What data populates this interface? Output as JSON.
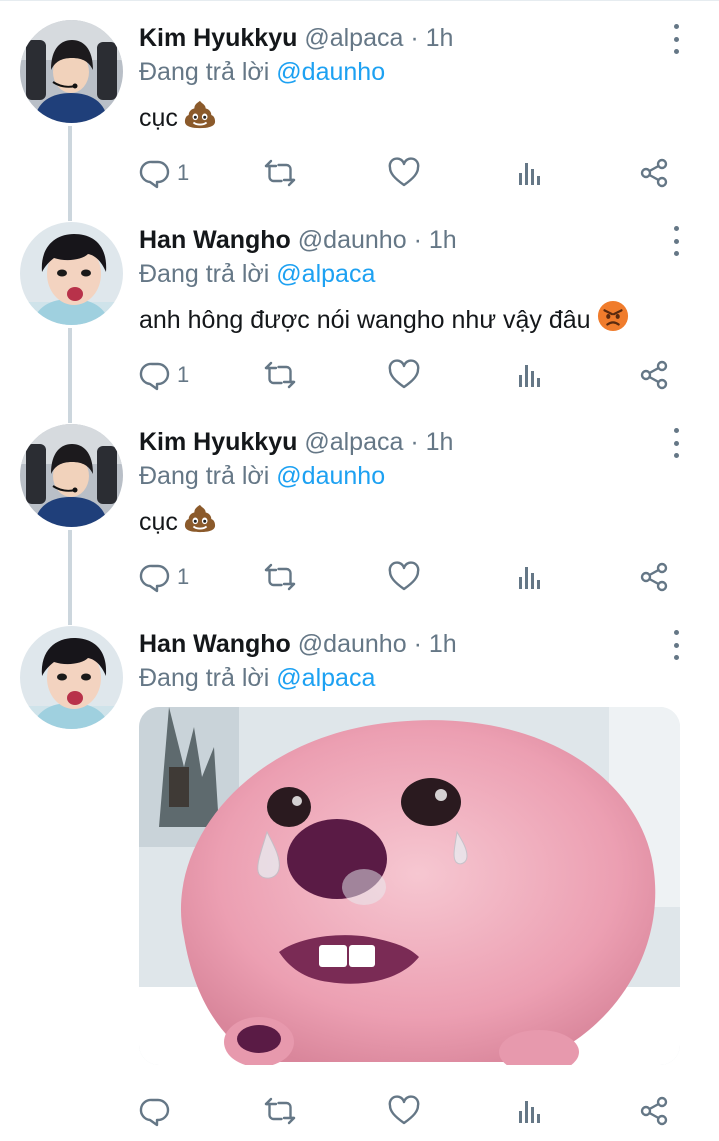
{
  "tweets": [
    {
      "name": "Kim Hyukkyu",
      "handle": "@alpaca",
      "separator": "·",
      "time": "1h",
      "reply_prefix": "Đang trả lời",
      "reply_to": "@daunho",
      "text": "cục",
      "emoji": "pile-of-poo",
      "reply_count": "1"
    },
    {
      "name": "Han Wangho",
      "handle": "@daunho",
      "separator": "·",
      "time": "1h",
      "reply_prefix": "Đang trả lời",
      "reply_to": "@alpaca",
      "text": "anh hông được nói wangho như vậy đâu",
      "emoji": "angry-face",
      "reply_count": "1"
    },
    {
      "name": "Kim Hyukkyu",
      "handle": "@alpaca",
      "separator": "·",
      "time": "1h",
      "reply_prefix": "Đang trả lời",
      "reply_to": "@daunho",
      "text": "cục",
      "emoji": "pile-of-poo",
      "reply_count": "1"
    },
    {
      "name": "Han Wangho",
      "handle": "@daunho",
      "separator": "·",
      "time": "1h",
      "reply_prefix": "Đang trả lời",
      "reply_to": "@alpaca",
      "media": "crying-pink-beaver-image",
      "reply_count": ""
    }
  ],
  "icons": [
    "reply-icon",
    "retweet-icon",
    "like-icon",
    "analytics-icon",
    "share-icon",
    "more-icon"
  ],
  "colors": {
    "accent": "#1da1f2",
    "secondary": "#657786",
    "text": "#14171a",
    "thread_line": "#ccd6dd"
  }
}
